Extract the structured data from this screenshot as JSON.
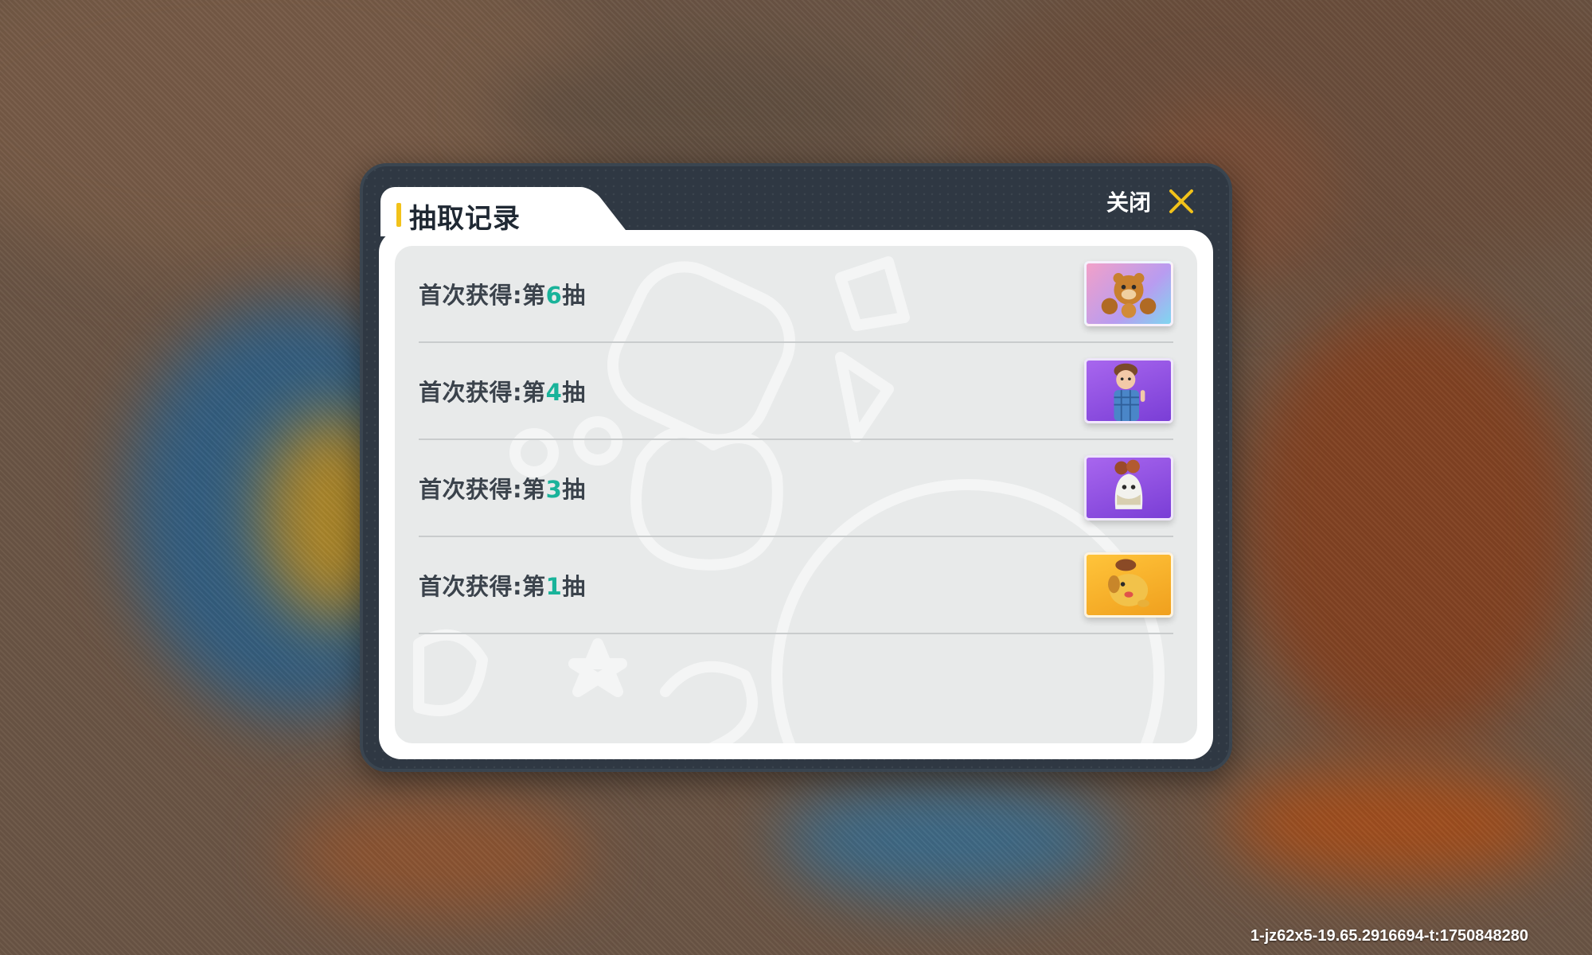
{
  "dialog": {
    "title": "抽取记录",
    "close_label": "关闭",
    "accent_color": "#f2c21a",
    "number_color": "#19b39a"
  },
  "records": [
    {
      "prefix": "首次获得:第",
      "number": "6",
      "suffix": "抽",
      "icon": "bear-bundle-icon",
      "bg": "#d9a0e6"
    },
    {
      "prefix": "首次获得:第",
      "number": "4",
      "suffix": "抽",
      "icon": "boy-character-icon",
      "bg": "#8c4ee0"
    },
    {
      "prefix": "首次获得:第",
      "number": "3",
      "suffix": "抽",
      "icon": "mushroom-ghost-icon",
      "bg": "#8c4ee0"
    },
    {
      "prefix": "首次获得:第",
      "number": "1",
      "suffix": "抽",
      "icon": "mushroom-dog-icon",
      "bg": "#f4b12a"
    }
  ],
  "watermark": "1-jz62x5-19.65.2916694-t:1750848280"
}
